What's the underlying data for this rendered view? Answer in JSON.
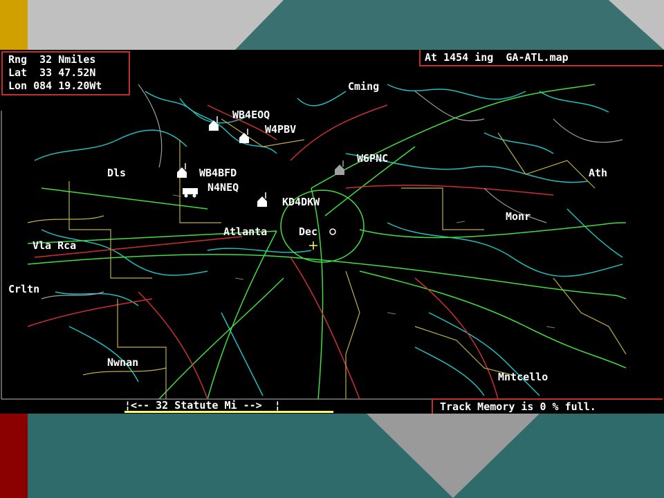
{
  "header": {
    "range": "Rng  32 Nmiles",
    "lat": "Lat  33 47.52N",
    "lon": "Lon 084 19.20Wt",
    "time_map": "At 1454 ing  GA-ATL.map"
  },
  "footer": {
    "scale": "¦<-- 32 Statute Mi -->  ¦",
    "track_memory": "Track Memory is 0 % full."
  },
  "places": [
    {
      "name": "Cming"
    },
    {
      "name": "Dls"
    },
    {
      "name": "Ath"
    },
    {
      "name": "Monr"
    },
    {
      "name": "Atlanta"
    },
    {
      "name": "Dec"
    },
    {
      "name": "Vla Rca"
    },
    {
      "name": "Crltn"
    },
    {
      "name": "Nwnan"
    },
    {
      "name": "Mntcello"
    }
  ],
  "stations": [
    {
      "call": "WB4EOQ",
      "icon": "house-icon"
    },
    {
      "call": "W4PBV",
      "icon": "house-icon"
    },
    {
      "call": "W6PNC",
      "icon": "house-icon"
    },
    {
      "call": "WB4BFD",
      "icon": "house-icon"
    },
    {
      "call": "N4NEQ",
      "icon": "van-icon"
    },
    {
      "call": "KD4DKW",
      "icon": "house-icon"
    }
  ],
  "colors": {
    "background": "#000000",
    "text": "#ffffff",
    "box_border": "#c03030",
    "roads_cyan": "#20c0c0",
    "roads_green": "#40e040",
    "roads_red": "#d03030",
    "roads_yellow": "#c0b040",
    "roads_gray": "#a0a0a0",
    "slide_teal": "#3a7070",
    "slide_gold": "#d0a000",
    "slide_darkred": "#8b0000"
  }
}
